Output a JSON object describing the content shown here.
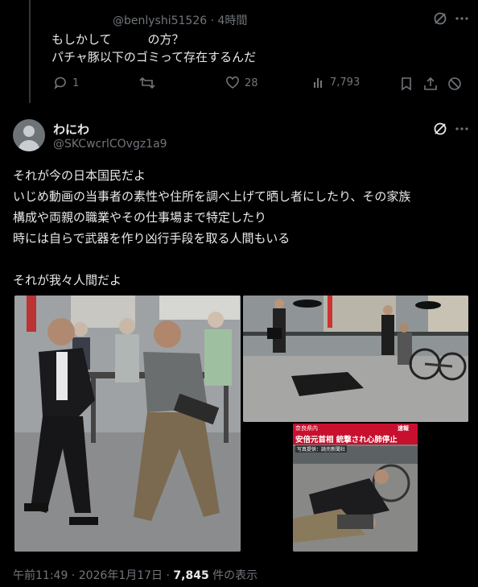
{
  "reply": {
    "handle_time": "@benlyshi51526 · 4時間",
    "line1": "もしかして　　　の方？",
    "line2": "パチャ豚以下のゴミって存在するんだ",
    "stats": {
      "replies": "1",
      "likes": "28",
      "views": "7,793"
    }
  },
  "main_post": {
    "display_name": "わにわ",
    "handle": "@SKCwcrlCOvgz1a9",
    "body_lines": [
      "それが今の日本国民だよ",
      "いじめ動画の当事者の素性や住所を調べ上げて晒し者にしたり、その家族",
      "構成や両親の職業やその仕事場まで特定したり",
      "時には自らで武器を作り凶行手段を取る人間もいる",
      "",
      "それが我々人間だよ"
    ],
    "images": {
      "right_bottom_banner_left": "奈良県内",
      "right_bottom_banner_right": "速報",
      "right_bottom_headline": "安倍元首相 銃撃され心肺停止",
      "right_bottom_credit": "写真提供：読売新聞社"
    },
    "footer": {
      "time": "午前11:49 · 2026年1月17日 · ",
      "views": "7,845",
      "views_suffix": " 件の表示"
    }
  },
  "colors": {
    "bg": "#000000",
    "text": "#e7e9ea",
    "muted": "#71767b",
    "banner_red": "#c8102e"
  }
}
